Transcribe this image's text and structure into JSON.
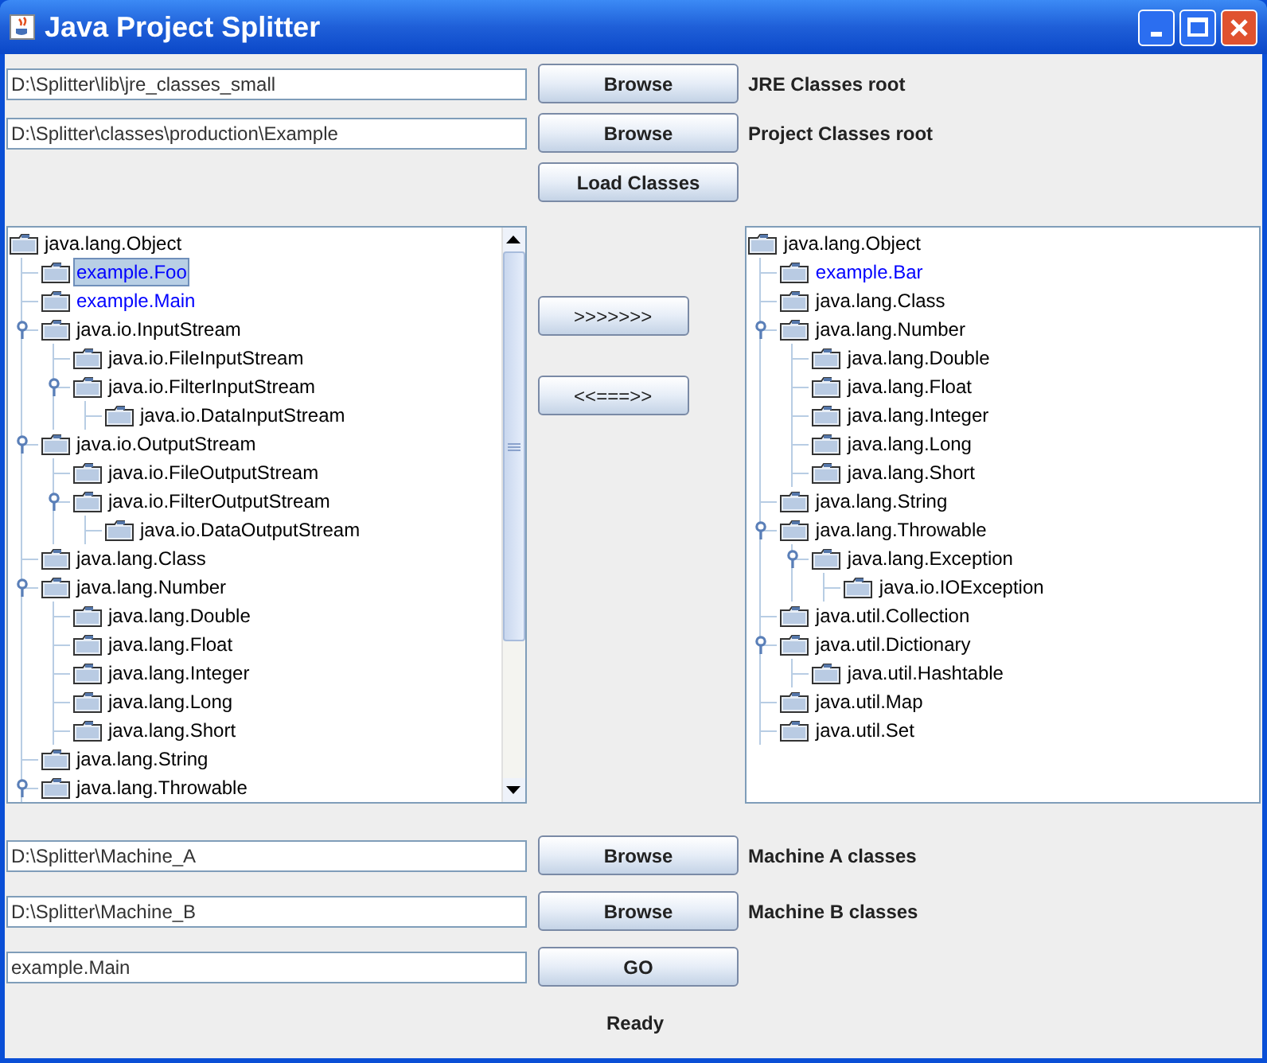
{
  "window": {
    "title": "Java Project Splitter"
  },
  "top_rows": [
    {
      "value": "D:\\Splitter\\lib\\jre_classes_small",
      "button": "Browse",
      "label": "JRE Classes root"
    },
    {
      "value": "D:\\Splitter\\classes\\production\\Example",
      "button": "Browse",
      "label": "Project Classes root"
    }
  ],
  "load_button": "Load Classes",
  "left_tree": [
    {
      "label": "java.lang.Object",
      "project": false,
      "selected": false,
      "children": [
        {
          "label": "example.Foo",
          "project": true,
          "selected": true
        },
        {
          "label": "example.Main",
          "project": true,
          "selected": false
        },
        {
          "label": "java.io.InputStream",
          "project": false,
          "selected": false,
          "expanded": true,
          "children": [
            {
              "label": "java.io.FileInputStream",
              "project": false,
              "selected": false
            },
            {
              "label": "java.io.FilterInputStream",
              "project": false,
              "selected": false,
              "expanded": true,
              "children": [
                {
                  "label": "java.io.DataInputStream",
                  "project": false,
                  "selected": false
                }
              ]
            }
          ]
        },
        {
          "label": "java.io.OutputStream",
          "project": false,
          "selected": false,
          "expanded": true,
          "children": [
            {
              "label": "java.io.FileOutputStream",
              "project": false,
              "selected": false
            },
            {
              "label": "java.io.FilterOutputStream",
              "project": false,
              "selected": false,
              "expanded": true,
              "children": [
                {
                  "label": "java.io.DataOutputStream",
                  "project": false,
                  "selected": false
                }
              ]
            }
          ]
        },
        {
          "label": "java.lang.Class",
          "project": false,
          "selected": false
        },
        {
          "label": "java.lang.Number",
          "project": false,
          "selected": false,
          "expanded": true,
          "children": [
            {
              "label": "java.lang.Double",
              "project": false,
              "selected": false
            },
            {
              "label": "java.lang.Float",
              "project": false,
              "selected": false
            },
            {
              "label": "java.lang.Integer",
              "project": false,
              "selected": false
            },
            {
              "label": "java.lang.Long",
              "project": false,
              "selected": false
            },
            {
              "label": "java.lang.Short",
              "project": false,
              "selected": false
            }
          ]
        },
        {
          "label": "java.lang.String",
          "project": false,
          "selected": false
        },
        {
          "label": "java.lang.Throwable",
          "project": false,
          "selected": false,
          "expanded": true
        }
      ]
    }
  ],
  "move_buttons": [
    ">>>>>>>",
    "<<===>>"
  ],
  "right_tree": [
    {
      "label": "java.lang.Object",
      "project": false,
      "selected": false,
      "children": [
        {
          "label": "example.Bar",
          "project": true,
          "selected": false
        },
        {
          "label": "java.lang.Class",
          "project": false,
          "selected": false
        },
        {
          "label": "java.lang.Number",
          "project": false,
          "selected": false,
          "expanded": true,
          "children": [
            {
              "label": "java.lang.Double",
              "project": false,
              "selected": false
            },
            {
              "label": "java.lang.Float",
              "project": false,
              "selected": false
            },
            {
              "label": "java.lang.Integer",
              "project": false,
              "selected": false
            },
            {
              "label": "java.lang.Long",
              "project": false,
              "selected": false
            },
            {
              "label": "java.lang.Short",
              "project": false,
              "selected": false
            }
          ]
        },
        {
          "label": "java.lang.String",
          "project": false,
          "selected": false
        },
        {
          "label": "java.lang.Throwable",
          "project": false,
          "selected": false,
          "expanded": true,
          "children": [
            {
              "label": "java.lang.Exception",
              "project": false,
              "selected": false,
              "expanded": true,
              "children": [
                {
                  "label": "java.io.IOException",
                  "project": false,
                  "selected": false
                }
              ]
            }
          ]
        },
        {
          "label": "java.util.Collection",
          "project": false,
          "selected": false
        },
        {
          "label": "java.util.Dictionary",
          "project": false,
          "selected": false,
          "expanded": true,
          "children": [
            {
              "label": "java.util.Hashtable",
              "project": false,
              "selected": false
            }
          ]
        },
        {
          "label": "java.util.Map",
          "project": false,
          "selected": false
        },
        {
          "label": "java.util.Set",
          "project": false,
          "selected": false
        }
      ]
    }
  ],
  "bottom_rows": [
    {
      "value": "D:\\Splitter\\Machine_A",
      "button": "Browse",
      "label": "Machine A classes"
    },
    {
      "value": "D:\\Splitter\\Machine_B",
      "button": "Browse",
      "label": "Machine B classes"
    },
    {
      "value": "example.Main",
      "button": "GO"
    }
  ],
  "status": "Ready"
}
